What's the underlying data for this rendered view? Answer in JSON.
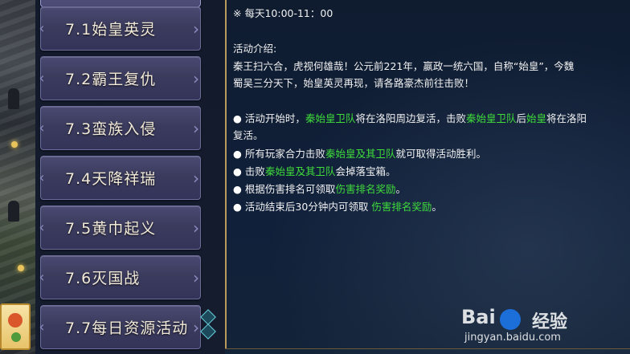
{
  "menu": {
    "items": [
      {
        "label": "7.1始皇英灵"
      },
      {
        "label": "7.2霸王复仇"
      },
      {
        "label": "7.3蛮族入侵"
      },
      {
        "label": "7.4天降祥瑞"
      },
      {
        "label": "7.5黄巾起义"
      },
      {
        "label": "7.6灭国战"
      },
      {
        "label": "7.7每日资源活动"
      }
    ]
  },
  "panel": {
    "time": "※ 每天10:00-11：00",
    "intro_title": "活动介绍:",
    "intro_line1": "秦王扫六合，虎视何雄哉！公元前221年，嬴政一统六国，自称“始皇”，今魏",
    "intro_line2": "蜀吴三分天下，始皇英灵再现，请各路豪杰前往击败！",
    "rules": [
      {
        "a": "活动开始时，",
        "b": "秦始皇卫队",
        "c": "将在洛阳周边复活，击败",
        "d": "秦始皇卫队",
        "e": "后",
        "f": "始皇",
        "g": "将在洛阳"
      },
      {
        "cont": "复活。"
      },
      {
        "a": "所有玩家合力击败",
        "b": "秦始皇及其卫队",
        "c": "就可取得活动胜利。"
      },
      {
        "a": "击败",
        "b": "秦始皇及其卫队",
        "c": "会掉落宝箱。"
      },
      {
        "a": "根据伤害排名可领取",
        "b": "伤害排名奖励",
        "c": "。"
      },
      {
        "a": "活动结束后30分钟内可领取 ",
        "b": "伤害排名奖励",
        "c": "。"
      }
    ],
    "bullet": "●"
  },
  "watermark": {
    "brand": "Bai",
    "brand2": "经验",
    "url": "jingyan.baidu.com"
  },
  "colors": {
    "highlight": "#3fdc3a",
    "text": "#f1f1f1",
    "menu_bg": "#3b3b5e"
  }
}
